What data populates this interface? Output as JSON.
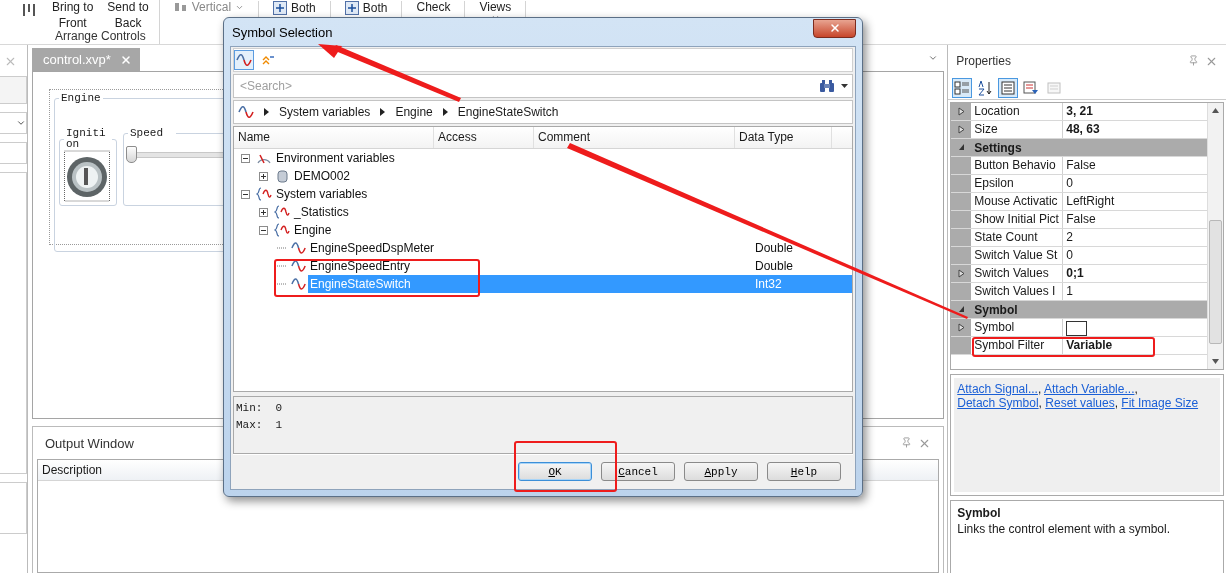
{
  "ribbon": {
    "items": [
      {
        "kind": "tall",
        "lines": [
          "Bring to",
          "Front"
        ]
      },
      {
        "kind": "tall",
        "lines": [
          "Send to",
          "Back"
        ]
      },
      {
        "kind": "dropdown",
        "lines": [
          "Vertical"
        ]
      },
      {
        "kind": "icon-label",
        "lines": [
          "Both"
        ]
      },
      {
        "kind": "icon-label",
        "lines": [
          "Both"
        ]
      },
      {
        "kind": "plain",
        "lines": [
          "Check"
        ]
      },
      {
        "kind": "menu",
        "lines": [
          "Views"
        ]
      }
    ],
    "group_label": "Arrange Controls"
  },
  "document": {
    "tab": {
      "label": "control.xvp*",
      "selected": true
    },
    "designer": {
      "group": "Engine",
      "ignition": "Igniti on",
      "speed": "Speed",
      "speed_level": {
        "level": 0
      }
    }
  },
  "output": {
    "title": "Output Window",
    "columns": [
      "Description"
    ]
  },
  "properties": {
    "title": "Properties",
    "toolbar": [
      {
        "kind": "categorized",
        "selected": true,
        "disabled": false
      },
      {
        "kind": "alphabetical",
        "selected": false,
        "disabled": false
      },
      {
        "kind": "properties",
        "selected": true,
        "disabled": false
      },
      {
        "kind": "events",
        "selected": false,
        "disabled": false
      },
      {
        "kind": "pages",
        "selected": false,
        "disabled": true
      }
    ],
    "rows": [
      {
        "kind": "property",
        "name": "Location",
        "value": "3, 21",
        "bold": true,
        "expandable": true
      },
      {
        "kind": "property",
        "name": "Size",
        "value": "48, 63",
        "bold": true,
        "expandable": true
      },
      {
        "kind": "category",
        "name": "Settings",
        "expanded": true
      },
      {
        "kind": "property",
        "name": "Button Behavio",
        "value": "False",
        "bold": false,
        "expandable": false
      },
      {
        "kind": "property",
        "name": "Epsilon",
        "value": "0",
        "bold": false,
        "expandable": false
      },
      {
        "kind": "property",
        "name": "Mouse Activatic",
        "value": "LeftRight",
        "bold": false,
        "expandable": false
      },
      {
        "kind": "property",
        "name": "Show Initial Pict",
        "value": "False",
        "bold": false,
        "expandable": false
      },
      {
        "kind": "property",
        "name": "State Count",
        "value": "2",
        "bold": false,
        "expandable": false
      },
      {
        "kind": "property",
        "name": "Switch Value St",
        "value": "0",
        "bold": false,
        "expandable": false
      },
      {
        "kind": "property",
        "name": "Switch Values",
        "value": "0;1",
        "bold": true,
        "expandable": true
      },
      {
        "kind": "property",
        "name": "Switch Values I",
        "value": "1",
        "bold": false,
        "expandable": false
      },
      {
        "kind": "category",
        "name": "Symbol",
        "expanded": true
      },
      {
        "kind": "swatch",
        "name": "Symbol",
        "expandable": true
      },
      {
        "kind": "property",
        "name": "Symbol Filter",
        "value": "Variable",
        "bold": true,
        "expandable": false
      }
    ],
    "commands": [
      {
        "label": "Attach Signal...",
        "separator": ","
      },
      {
        "label": "Attach Variable...",
        "separator": ","
      },
      {
        "label": "Detach Symbol",
        "separator": ","
      },
      {
        "label": "Reset values",
        "separator": ","
      },
      {
        "label": "Fit Image Size"
      }
    ],
    "description": {
      "title": "Symbol",
      "text": "Links the control element with a symbol."
    }
  },
  "dialog": {
    "title": "Symbol Selection",
    "toolbar": [
      {
        "kind": "signals",
        "selected": true
      },
      {
        "kind": "collapse",
        "selected": false
      }
    ],
    "search": {
      "placeholder": "<Search>"
    },
    "breadcrumb": [
      "System variables",
      "Engine",
      "EngineStateSwitch"
    ],
    "columns": [
      "Name",
      "Access",
      "Comment",
      "Data Type"
    ],
    "tree": [
      {
        "kind": "environment",
        "name": "Environment variables",
        "expanded": true,
        "children": [
          {
            "kind": "database",
            "name": "DEMO002",
            "expanded": false
          }
        ]
      },
      {
        "kind": "namespace",
        "name": "System variables",
        "expanded": true,
        "children": [
          {
            "kind": "namespace",
            "name": "_Statistics",
            "expanded": false
          },
          {
            "kind": "namespace",
            "name": "Engine",
            "expanded": true,
            "children": [
              {
                "kind": "variable",
                "name": "EngineSpeedDspMeter",
                "type": "Double",
                "selected": false
              },
              {
                "kind": "variable",
                "name": "EngineSpeedEntry",
                "type": "Double",
                "selected": false
              },
              {
                "kind": "variable",
                "name": "EngineStateSwitch",
                "type": "Int32",
                "selected": true
              }
            ]
          }
        ]
      }
    ],
    "info": [
      "Min:  0",
      "Max:  1"
    ],
    "buttons": [
      {
        "label": "OK",
        "default": true
      },
      {
        "label": "Cancel",
        "default": false
      },
      {
        "label": "Apply",
        "default": false
      },
      {
        "label": "Help",
        "default": false
      }
    ]
  },
  "annotations": [
    {
      "kind": "box"
    },
    {
      "kind": "box"
    },
    {
      "kind": "box"
    },
    {
      "kind": "arrow"
    }
  ]
}
